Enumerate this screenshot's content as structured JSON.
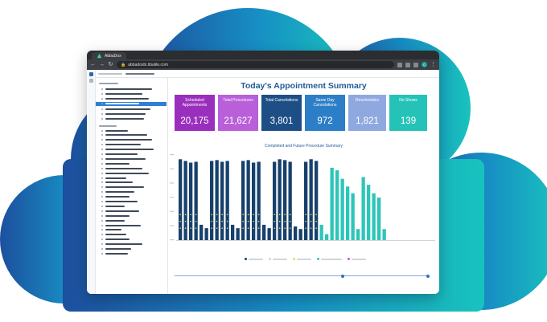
{
  "browser": {
    "tab_title": "AbbaDox",
    "url": "abbadoxbi.tibalite.com",
    "profile_initial": "C"
  },
  "dashboard": {
    "title": "Today's Appointment Summary",
    "chart_subtitle": "Completed and Future Procedure Summary"
  },
  "kpis": [
    {
      "label": "Scheduled Appointments",
      "value": "20,175",
      "color": "#9b2fbd"
    },
    {
      "label": "Total Procedures",
      "value": "21,627",
      "color": "#b85fd9"
    },
    {
      "label": "Total Cancelations",
      "value": "3,801",
      "color": "#1d4f86"
    },
    {
      "label": "Same Day Cancelations",
      "value": "972",
      "color": "#2c7fc7"
    },
    {
      "label": "Reschedules",
      "value": "1,821",
      "color": "#8fa9e0"
    },
    {
      "label": "No Shows",
      "value": "139",
      "color": "#25c3b7"
    }
  ],
  "colors": {
    "bar_completed": "#17406c",
    "bar_future": "#2cc6b8",
    "marker": "#e8d95a",
    "cloud_left": "#1d4f9e",
    "cloud_right": "#18c3bd"
  },
  "chart_data": {
    "type": "bar",
    "series": [
      {
        "values": [
          0.95,
          0.93,
          0.91,
          0.92,
          0.18,
          0.14,
          0.93,
          0.94,
          0.92,
          0.93,
          0.18,
          0.14,
          0.93,
          0.94,
          0.91,
          0.92,
          0.18,
          0.14,
          0.92,
          0.95,
          0.94,
          0.92,
          0.16,
          0.13,
          0.92,
          0.95,
          0.93
        ]
      },
      {
        "values": [
          0.18,
          0.07,
          0.85,
          0.82,
          0.72,
          0.63,
          0.55,
          0.13,
          0.74,
          0.65,
          0.55,
          0.5,
          0.13
        ]
      }
    ],
    "y_normalized": true,
    "grid": false
  }
}
